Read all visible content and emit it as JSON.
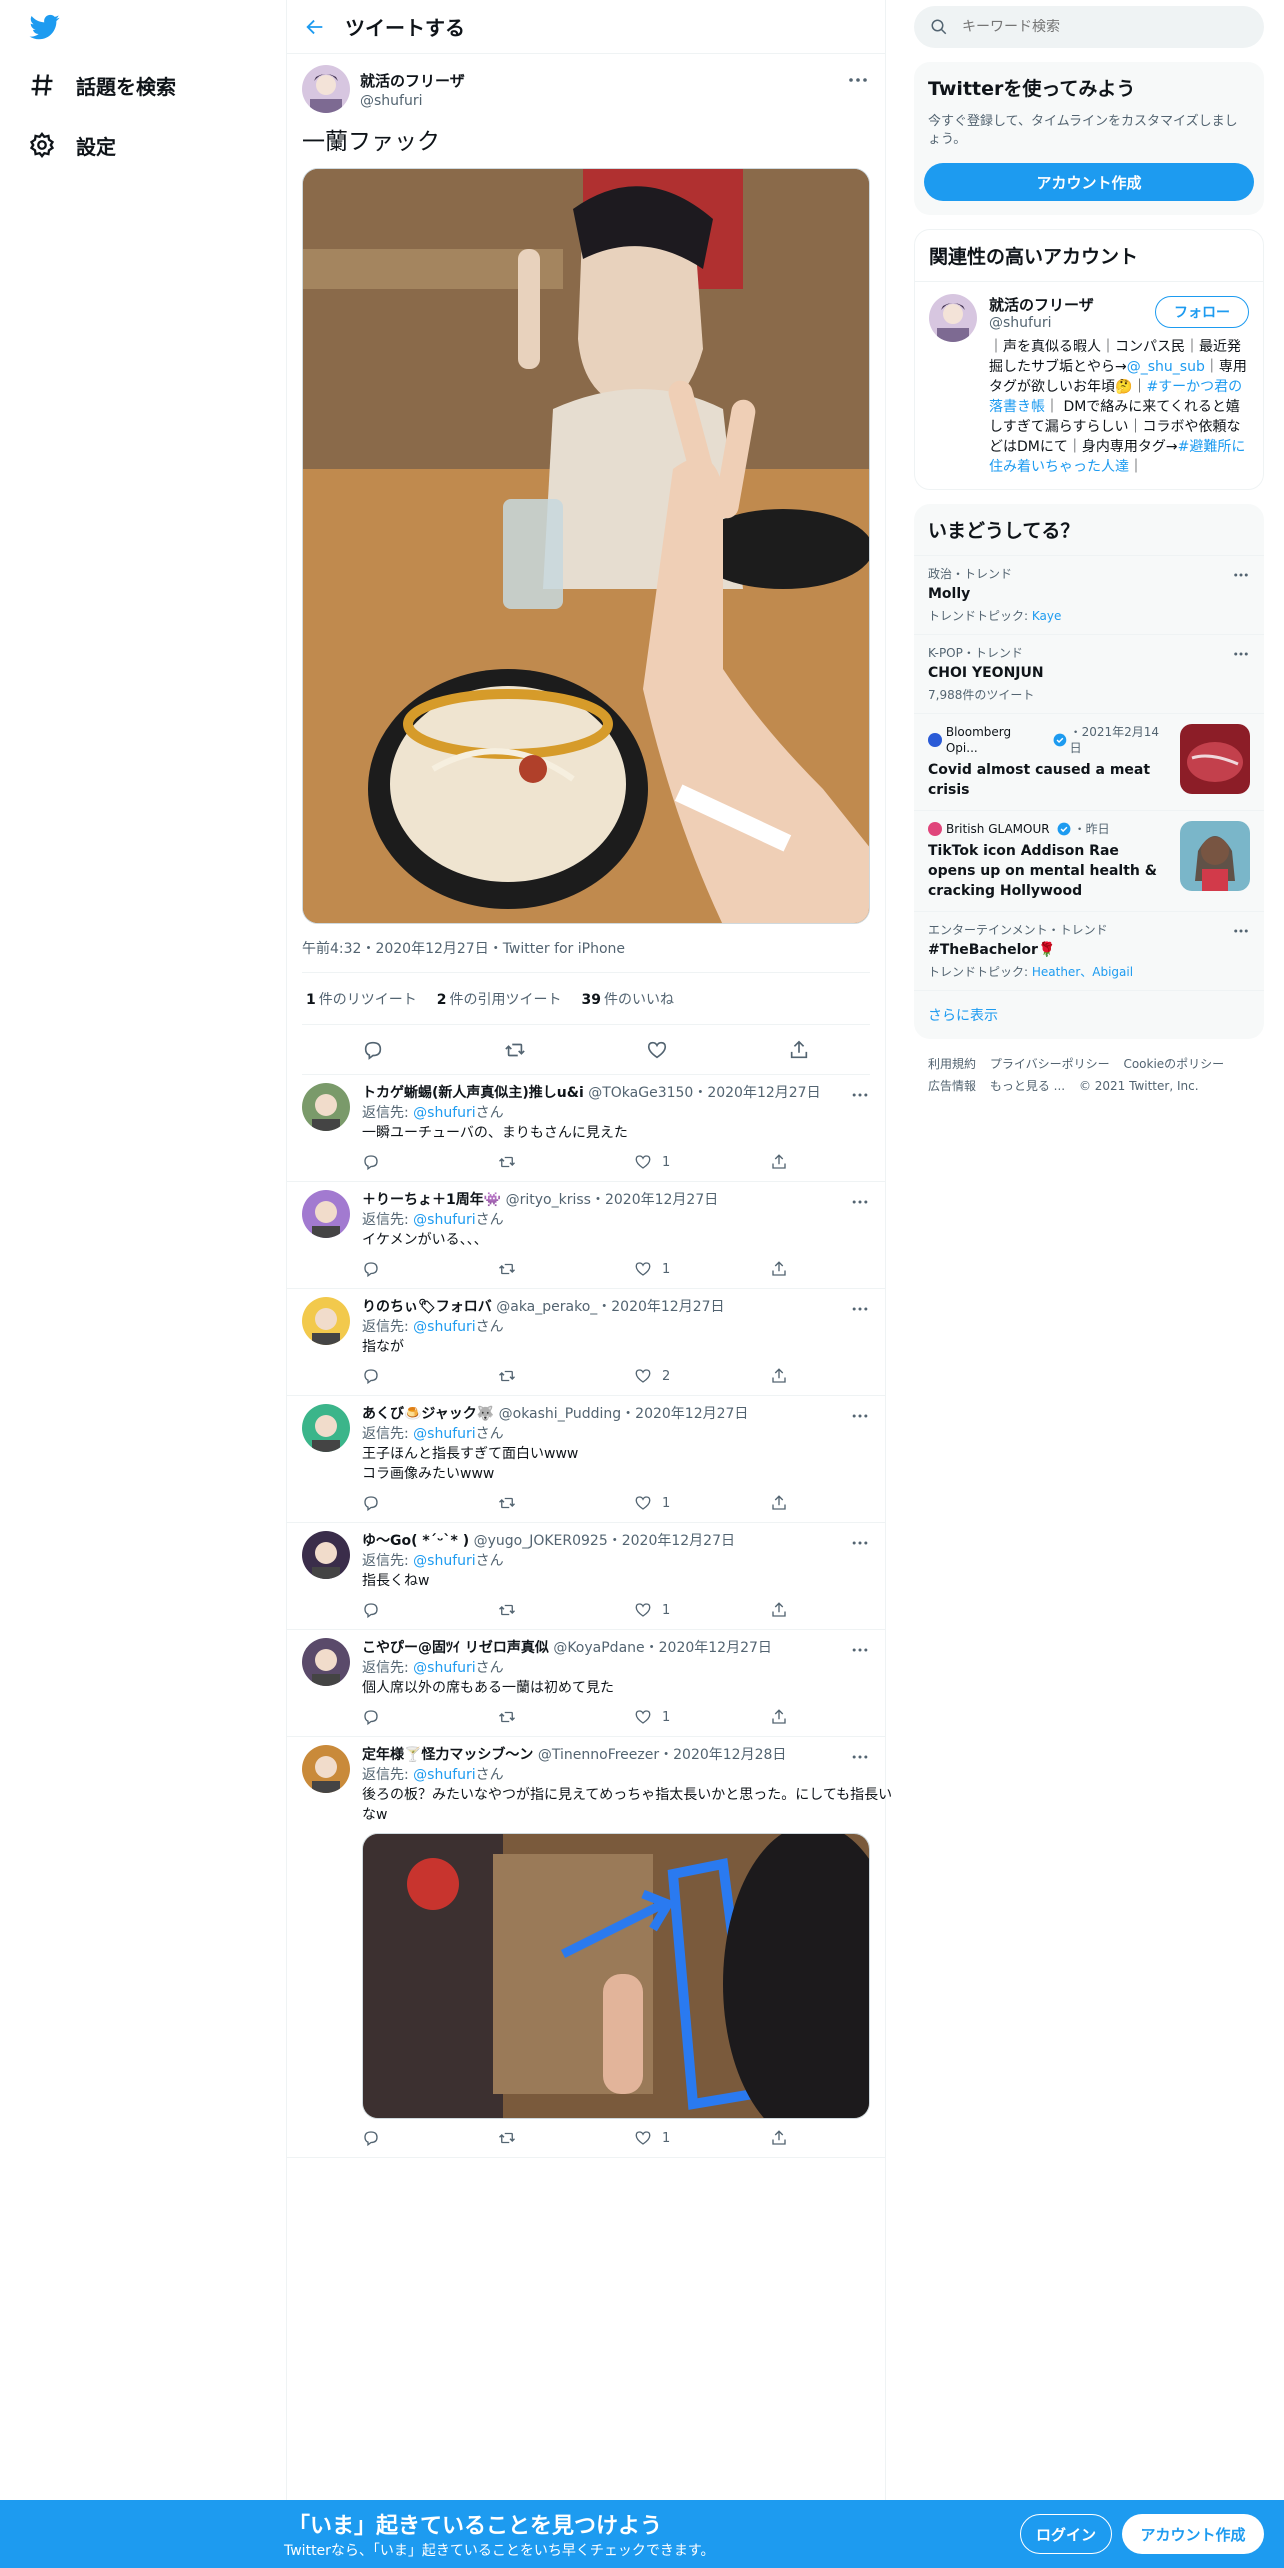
{
  "nav": {
    "explore_label": "話題を検索",
    "settings_label": "設定"
  },
  "header": {
    "title": "ツイートする"
  },
  "tweet": {
    "author_name": "就活のフリーザ",
    "author_handle": "@shufuri",
    "text": "一蘭ファック",
    "meta": "午前4:32・2020年12月27日・Twitter for iPhone",
    "stats": [
      {
        "count": "1",
        "label": "件のリツイート"
      },
      {
        "count": "2",
        "label": "件の引用ツイート"
      },
      {
        "count": "39",
        "label": "件のいいね"
      }
    ]
  },
  "replies": [
    {
      "name": "トカゲ蜥蜴(新人声真似主)推しu&i",
      "rest": "@TOkaGe3150・2020年12月27日",
      "reply_prefix": "返信先: ",
      "reply_handle": "@shufuri",
      "reply_suffix": "さん",
      "text": "一瞬ユーチューバの、まりもさんに見えた",
      "likes": "1",
      "avatar_color": "#7a9a6a"
    },
    {
      "name": "＋りーちょ＋1周年👾",
      "rest": "@rityo_kriss・2020年12月27日",
      "reply_prefix": "返信先: ",
      "reply_handle": "@shufuri",
      "reply_suffix": "さん",
      "text": "イケメンがいる、、、",
      "likes": "1",
      "avatar_color": "#a27ad0"
    },
    {
      "name": "りのちぃ🏷フォロバ",
      "rest": "@aka_perako_・2020年12月27日",
      "reply_prefix": "返信先: ",
      "reply_handle": "@shufuri",
      "reply_suffix": "さん",
      "text": "指なが",
      "likes": "2",
      "avatar_color": "#f2c94c"
    },
    {
      "name": "あくび🍮ジャック🐺",
      "rest": "@okashi_Pudding・2020年12月27日",
      "reply_prefix": "返信先: ",
      "reply_handle": "@shufuri",
      "reply_suffix": "さん",
      "text": "王子ほんと指長すぎて面白いwww\nコラ画像みたいwww",
      "likes": "1",
      "avatar_color": "#3bb58a"
    },
    {
      "name": "ゆ〜Go( *ˊᵕˋ* )",
      "rest": "@yugo_JOKER0925・2020年12月27日",
      "reply_prefix": "返信先: ",
      "reply_handle": "@shufuri",
      "reply_suffix": "さん",
      "text": "指長くねw",
      "likes": "1",
      "avatar_color": "#3a2d4a"
    },
    {
      "name": "こやぴー@固ﾂｲ リゼロ声真似",
      "rest": "@KoyaPdane・2020年12月27日",
      "reply_prefix": "返信先: ",
      "reply_handle": "@shufuri",
      "reply_suffix": "さん",
      "text": "個人席以外の席もある一蘭は初めて見た",
      "likes": "1",
      "avatar_color": "#5a4a6a"
    },
    {
      "name": "定年様🍸怪力マッシブ〜ン",
      "rest": "@TinennoFreezer・2020年12月28日",
      "reply_prefix": "返信先: ",
      "reply_handle": "@shufuri",
      "reply_suffix": "さん",
      "text": "後ろの板？みたいなやつが指に見えてめっちゃ指太長いかと思った。にしても指長いなw",
      "likes": "1",
      "avatar_color": "#c98a3a"
    }
  ],
  "search": {
    "placeholder": "キーワード検索"
  },
  "signup_card": {
    "title": "Twitterを使ってみよう",
    "sub": "今すぐ登録して、タイムラインをカスタマイズしましょう。",
    "button": "アカウント作成"
  },
  "related": {
    "title": "関連性の高いアカウント",
    "name": "就活のフリーザ",
    "handle": "@shufuri",
    "follow": "フォロー",
    "bio_a": "｜声を真似る暇人｜コンパス民｜最近発掘したサブ垢とやら→",
    "bio_link1": "@_shu_sub",
    "bio_b": "｜専用タグが欲しいお年頃🤔｜",
    "bio_link2": "#すーかつ君の落書き帳",
    "bio_c": "｜ DMで絡みに来てくれると嬉しすぎて漏らすらしい｜コラボや依頼などはDMにて｜身内専用タグ→",
    "bio_link3": "#避難所に住み着いちゃった人達",
    "bio_d": "｜"
  },
  "trends": {
    "title": "いまどうしてる？",
    "items": [
      {
        "cat": "政治・トレンド",
        "title": "Molly",
        "sub_prefix": "トレンドトピック: ",
        "sub_link": "Kaye"
      },
      {
        "cat": "K-POP・トレンド",
        "title": "CHOI YEONJUN",
        "sub_prefix": "7,988件のツイート",
        "sub_link": ""
      }
    ],
    "news": [
      {
        "source": "Bloomberg Opi...",
        "time": "・2021年2月14日",
        "title": "Covid almost caused a meat crisis",
        "thumb_color": "#b8323c"
      },
      {
        "source": "British GLAMOUR",
        "time": "・昨日",
        "title": "TikTok icon Addison Rae opens up on mental health & cracking Hollywood",
        "thumb_color": "#d9a08a"
      }
    ],
    "last": {
      "cat": "エンターテインメント・トレンド",
      "title": "#TheBachelor🌹",
      "sub_prefix": "トレンドトピック: ",
      "sub_link": "Heather、Abigail"
    },
    "show_more": "さらに表示"
  },
  "footer": {
    "links": [
      "利用規約",
      "プライバシーポリシー",
      "Cookieのポリシー",
      "広告情報",
      "もっと見る ...",
      "© 2021 Twitter, Inc."
    ]
  },
  "bottombar": {
    "title": "「いま」起きていることを見つけよう",
    "sub": "Twitterなら、「いま」起きていることをいち早くチェックできます。",
    "login": "ログイン",
    "create": "アカウント作成"
  },
  "colors": {
    "accent": "#1d9bf0",
    "text": "#0f1419",
    "muted": "#536471"
  }
}
